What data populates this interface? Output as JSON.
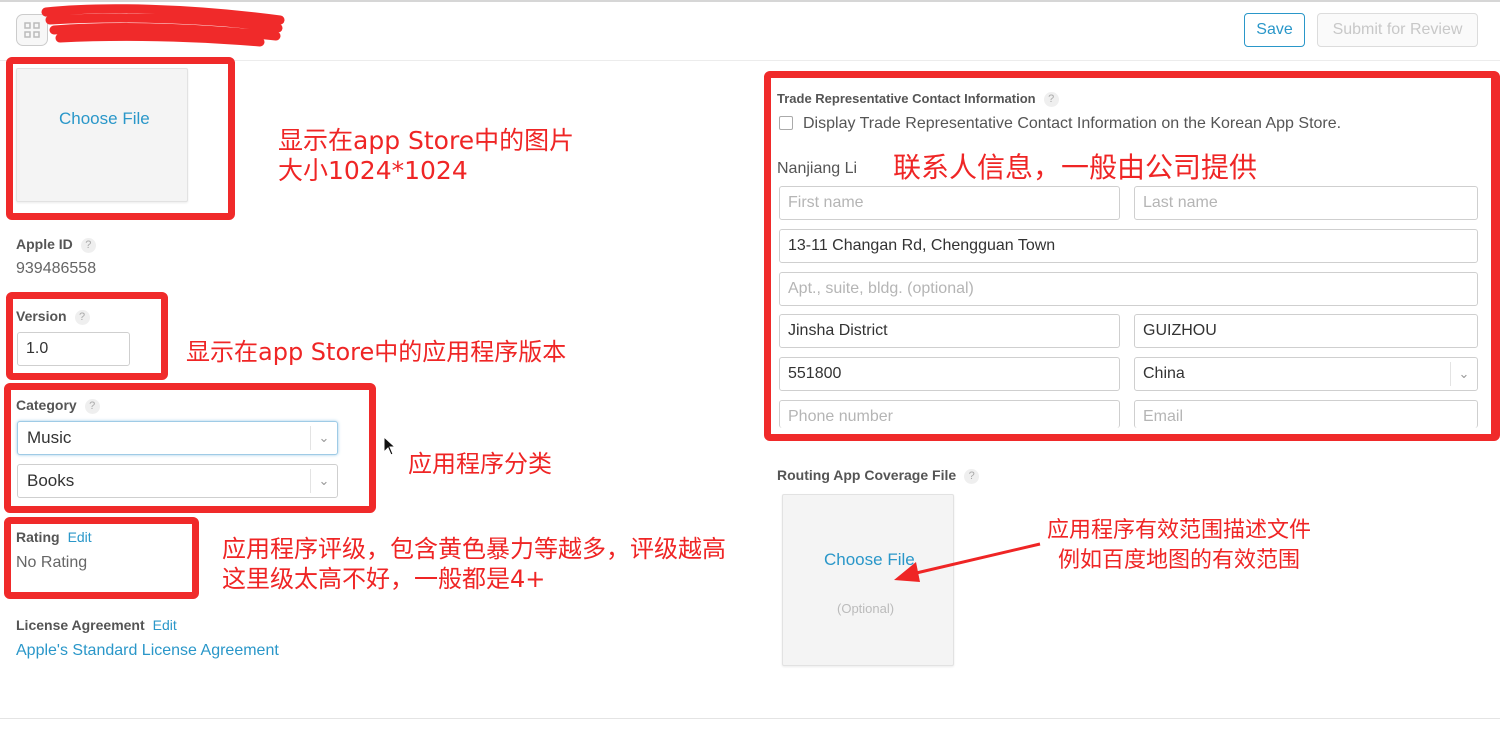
{
  "header": {
    "save_label": "Save",
    "submit_label": "Submit for Review"
  },
  "app_image": {
    "choose_label": "Choose File"
  },
  "apple_id": {
    "label": "Apple ID",
    "value": "939486558"
  },
  "version": {
    "label": "Version",
    "value": "1.0"
  },
  "category": {
    "label": "Category",
    "primary": "Music",
    "secondary": "Books"
  },
  "rating": {
    "label": "Rating",
    "edit": "Edit",
    "value": "No Rating"
  },
  "license": {
    "label": "License Agreement",
    "edit": "Edit",
    "link": "Apple's Standard License Agreement"
  },
  "trade": {
    "title": "Trade Representative Contact Information",
    "checkbox_label": "Display Trade Representative Contact Information on the Korean App Store.",
    "name": "Nanjiang Li",
    "first_name_ph": "First name",
    "last_name_ph": "Last name",
    "address": "13-11 Changan Rd, Chengguan Town",
    "apt_ph": "Apt., suite, bldg. (optional)",
    "city": "Jinsha District",
    "state": "GUIZHOU",
    "postal": "551800",
    "country": "China",
    "phone_ph": "Phone number",
    "email_ph": "Email"
  },
  "routing": {
    "label": "Routing App Coverage File",
    "choose_label": "Choose File",
    "optional": "(Optional)"
  },
  "annotations": {
    "image_line1": "显示在app Store中的图片",
    "image_line2": "大小1024*1024",
    "version": "显示在app Store中的应用程序版本",
    "category": "应用程序分类",
    "rating_line1": "应用程序评级，包含黄色暴力等越多，评级越高",
    "rating_line2": "这里级太高不好，一般都是4+",
    "contact": "联系人信息，一般由公司提供",
    "routing_line1": "应用程序有效范围描述文件",
    "routing_line2": "例如百度地图的有效范围"
  },
  "colors": {
    "accent": "#2a97c9",
    "annotation": "#f02a2a"
  }
}
